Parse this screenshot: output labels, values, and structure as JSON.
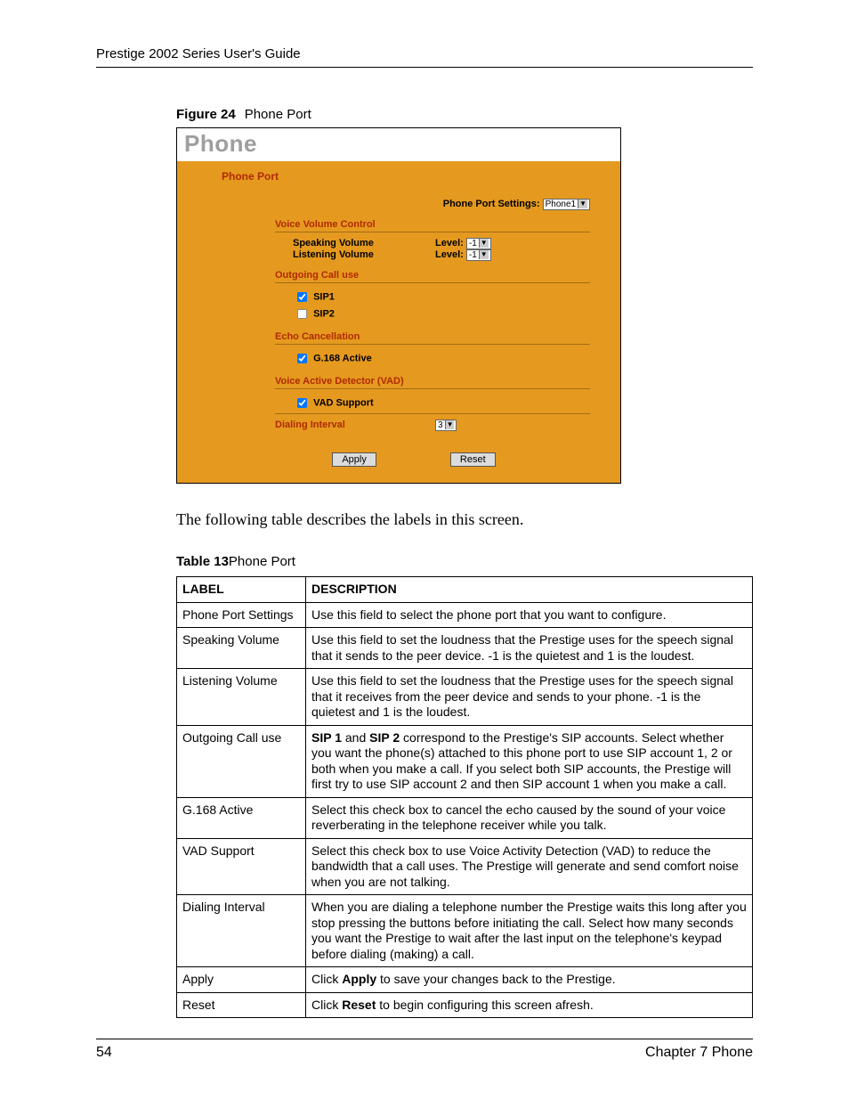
{
  "header": "Prestige 2002 Series User's Guide",
  "figure": {
    "label": "Figure 24",
    "title": "Phone Port"
  },
  "shot": {
    "title": "Phone",
    "phone_port_label": "Phone Port",
    "port_settings_label": "Phone Port Settings:",
    "port_settings_value": "Phone1",
    "sec_voice_vol": "Voice Volume Control",
    "speaking_volume": "Speaking Volume",
    "listening_volume": "Listening Volume",
    "level_label": "Level:",
    "level_value": "-1",
    "sec_outgoing": "Outgoing Call use",
    "sip1": "SIP1",
    "sip2": "SIP2",
    "sec_echo": "Echo Cancellation",
    "g168": "G.168 Active",
    "sec_vad": "Voice Active Detector (VAD)",
    "vad_support": "VAD Support",
    "sec_dial": "Dialing Interval",
    "dial_value": "3",
    "apply": "Apply",
    "reset": "Reset"
  },
  "body_text": "The following table describes the labels in this screen.",
  "table_caption": {
    "label": "Table 13",
    "title": "Phone Port"
  },
  "table": {
    "head_label": "LABEL",
    "head_desc": "DESCRIPTION",
    "rows": [
      {
        "label": "Phone Port Settings",
        "desc": "Use this field to select the phone port that you want to configure."
      },
      {
        "label": "Speaking Volume",
        "desc": "Use this field to set the loudness that the Prestige uses for the speech signal that it sends to the peer device. -1 is the quietest and 1 is the loudest."
      },
      {
        "label": "Listening Volume",
        "desc": "Use this field to set the loudness that the Prestige uses for the speech signal that it receives from the peer device and sends to your phone. -1 is the quietest and 1 is the loudest."
      },
      {
        "label": "Outgoing Call use",
        "desc_html": "<b>SIP 1</b> and <b>SIP 2</b> correspond to the Prestige's SIP accounts. Select whether you want the phone(s) attached to this phone port to use SIP account 1, 2 or both when you make a call. If you select both SIP accounts, the Prestige will first try to use SIP account 2 and then SIP account 1 when you make a call."
      },
      {
        "label": "G.168 Active",
        "desc": "Select this check box to cancel the echo caused by the sound of your voice reverberating in the telephone receiver while you talk."
      },
      {
        "label": "VAD Support",
        "desc": "Select this check box to use Voice Activity Detection (VAD) to reduce the bandwidth that a call uses. The Prestige will generate and send comfort noise when you are not talking."
      },
      {
        "label": "Dialing Interval",
        "desc": "When you are dialing a telephone number the Prestige waits this long after you stop pressing the buttons before initiating the call. Select how many seconds you want the Prestige to wait after the last input on the telephone's keypad before dialing (making) a call."
      },
      {
        "label": "Apply",
        "desc_html": "Click <b>Apply</b> to save your changes back to the Prestige."
      },
      {
        "label": "Reset",
        "desc_html": "Click <b>Reset</b> to begin configuring this screen afresh."
      }
    ]
  },
  "footer": {
    "page": "54",
    "chapter": "Chapter 7 Phone"
  }
}
